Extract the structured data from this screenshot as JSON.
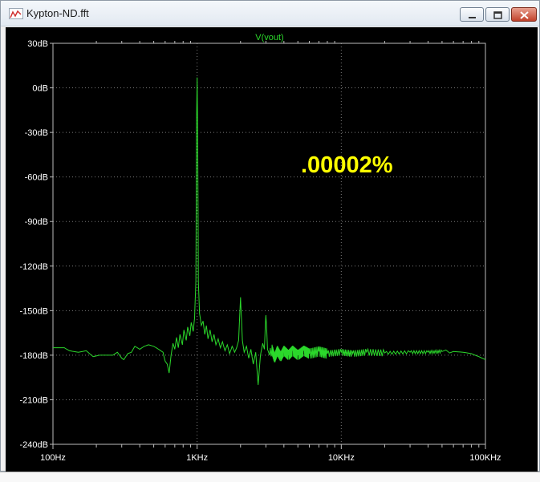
{
  "window": {
    "title": "Kypton-ND.fft"
  },
  "colors": {
    "trace": "#2bd82b",
    "grid": "#7a7a7a",
    "annotation": "#ffff00",
    "background": "#000000",
    "axis_labels": "#ffffff"
  },
  "annotation_text": ".00002%",
  "chart_data": {
    "type": "line",
    "title": "V(vout)",
    "xscale": "log",
    "xlim": [
      100,
      100000
    ],
    "ylim": [
      -240,
      30
    ],
    "x_tick_labels": [
      "100Hz",
      "1KHz",
      "10KHz",
      "100KHz"
    ],
    "y_tick_labels": [
      "30dB",
      "0dB",
      "-30dB",
      "-60dB",
      "-90dB",
      "-120dB",
      "-150dB",
      "-180dB",
      "-210dB",
      "-240dB"
    ],
    "grid": true,
    "series": [
      {
        "name": "V(vout)",
        "points": [
          [
            100,
            -175
          ],
          [
            110,
            -175
          ],
          [
            120,
            -175
          ],
          [
            130,
            -177
          ],
          [
            150,
            -178
          ],
          [
            170,
            -177
          ],
          [
            190,
            -181
          ],
          [
            210,
            -180
          ],
          [
            230,
            -180
          ],
          [
            260,
            -180
          ],
          [
            280,
            -178
          ],
          [
            300,
            -182
          ],
          [
            310,
            -183
          ],
          [
            330,
            -179
          ],
          [
            350,
            -178
          ],
          [
            370,
            -174
          ],
          [
            400,
            -176
          ],
          [
            430,
            -174
          ],
          [
            460,
            -173
          ],
          [
            500,
            -174
          ],
          [
            540,
            -176
          ],
          [
            560,
            -177
          ],
          [
            580,
            -178
          ],
          [
            600,
            -184
          ],
          [
            620,
            -186
          ],
          [
            640,
            -192
          ],
          [
            660,
            -180
          ],
          [
            680,
            -172
          ],
          [
            700,
            -176
          ],
          [
            720,
            -168
          ],
          [
            740,
            -175
          ],
          [
            760,
            -166
          ],
          [
            790,
            -173
          ],
          [
            810,
            -163
          ],
          [
            840,
            -170
          ],
          [
            860,
            -161
          ],
          [
            890,
            -167
          ],
          [
            910,
            -158
          ],
          [
            940,
            -164
          ],
          [
            960,
            -155
          ],
          [
            980,
            -130
          ],
          [
            990,
            -30
          ],
          [
            1000,
            7
          ],
          [
            1010,
            -35
          ],
          [
            1020,
            -130
          ],
          [
            1040,
            -152
          ],
          [
            1070,
            -160
          ],
          [
            1100,
            -157
          ],
          [
            1130,
            -166
          ],
          [
            1160,
            -160
          ],
          [
            1190,
            -169
          ],
          [
            1230,
            -163
          ],
          [
            1270,
            -171
          ],
          [
            1310,
            -166
          ],
          [
            1350,
            -173
          ],
          [
            1400,
            -169
          ],
          [
            1450,
            -175
          ],
          [
            1500,
            -171
          ],
          [
            1560,
            -177
          ],
          [
            1620,
            -173
          ],
          [
            1680,
            -179
          ],
          [
            1750,
            -174
          ],
          [
            1820,
            -178
          ],
          [
            1880,
            -175
          ],
          [
            1940,
            -170
          ],
          [
            1970,
            -155
          ],
          [
            2000,
            -141
          ],
          [
            2030,
            -155
          ],
          [
            2060,
            -170
          ],
          [
            2120,
            -178
          ],
          [
            2200,
            -174
          ],
          [
            2280,
            -182
          ],
          [
            2360,
            -176
          ],
          [
            2450,
            -186
          ],
          [
            2550,
            -178
          ],
          [
            2650,
            -200
          ],
          [
            2750,
            -180
          ],
          [
            2850,
            -172
          ],
          [
            2930,
            -176
          ],
          [
            2970,
            -160
          ],
          [
            3000,
            -153
          ],
          [
            3030,
            -160
          ],
          [
            3080,
            -176
          ],
          [
            3180,
            -180
          ],
          [
            3300,
            -176
          ],
          [
            3450,
            -182
          ],
          [
            3600,
            -177
          ],
          [
            3800,
            -181
          ],
          [
            4000,
            -177
          ],
          [
            4300,
            -180
          ],
          [
            4600,
            -177
          ],
          [
            5000,
            -180
          ],
          [
            5500,
            -177
          ],
          [
            6000,
            -179
          ],
          [
            7000,
            -177.5
          ],
          [
            8000,
            -179
          ],
          [
            10000,
            -178
          ],
          [
            12000,
            -179
          ],
          [
            15000,
            -178
          ],
          [
            20000,
            -178.5
          ],
          [
            30000,
            -178
          ],
          [
            40000,
            -178
          ],
          [
            50000,
            -177.5
          ],
          [
            60000,
            -177.5
          ],
          [
            70000,
            -178
          ],
          [
            80000,
            -179
          ],
          [
            90000,
            -181
          ],
          [
            100000,
            -183
          ]
        ]
      }
    ]
  }
}
